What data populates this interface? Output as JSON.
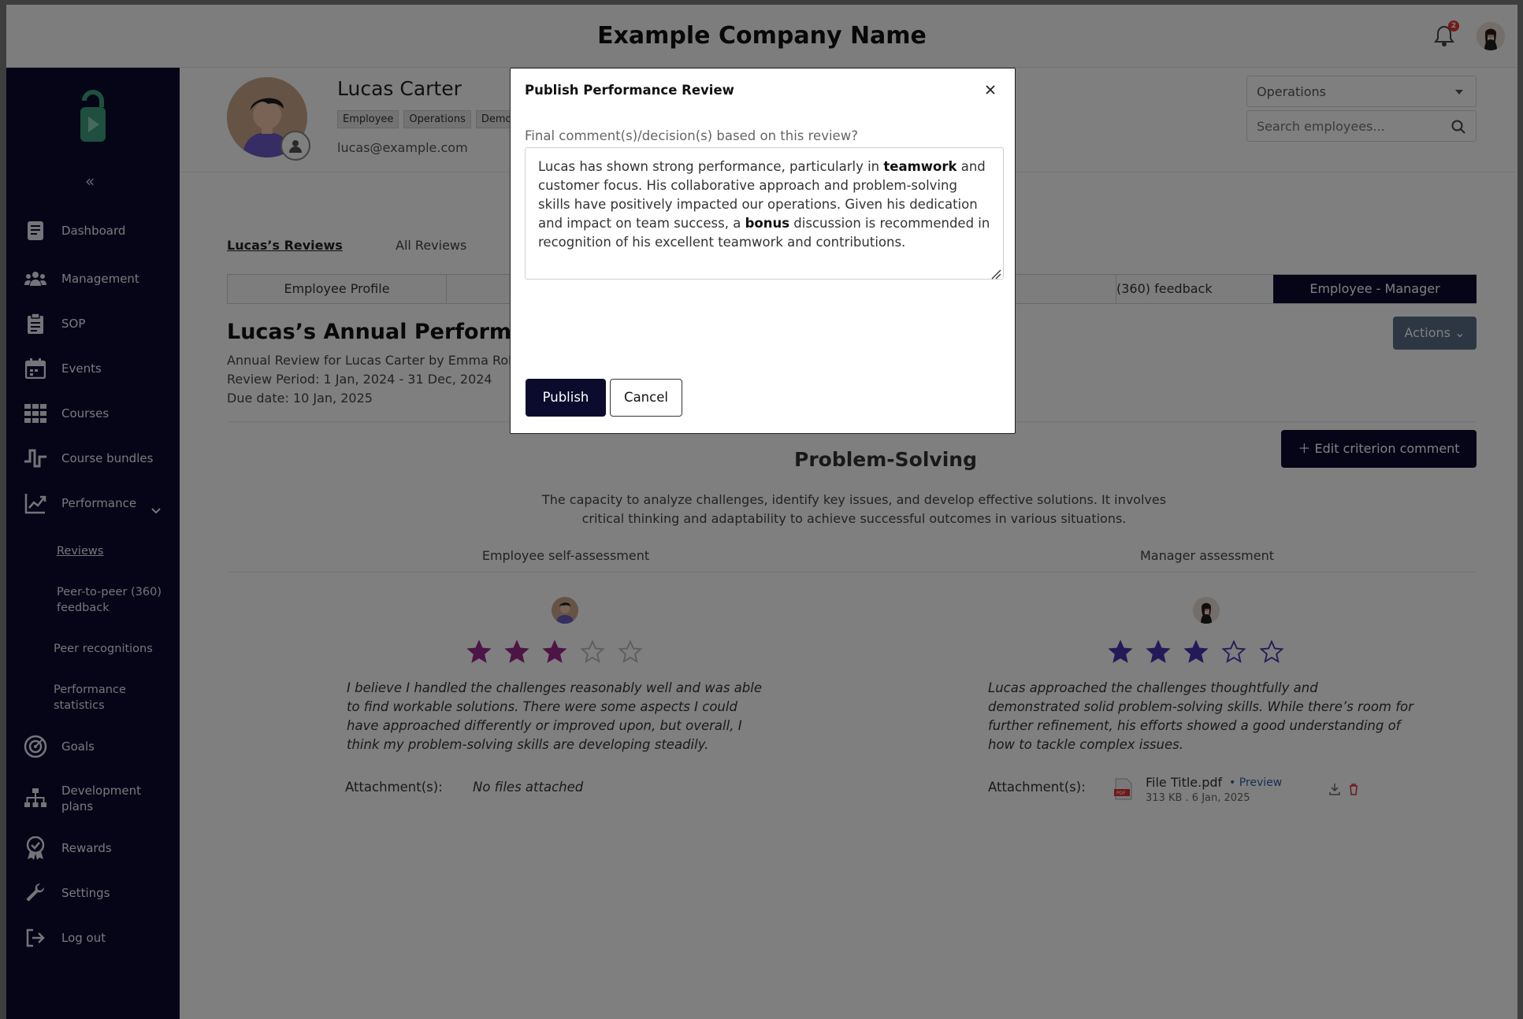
{
  "header": {
    "company_name": "Example Company Name",
    "notification_count": "2"
  },
  "sidebar": {
    "collapse_label": "«",
    "items": [
      {
        "label": "Dashboard",
        "icon": "dashboard-icon"
      },
      {
        "label": "Management",
        "icon": "management-icon"
      },
      {
        "label": "SOP",
        "icon": "clipboard-icon"
      },
      {
        "label": "Events",
        "icon": "calendar-icon"
      },
      {
        "label": "Courses",
        "icon": "grid-icon"
      },
      {
        "label": "Course bundles",
        "icon": "bundle-icon"
      },
      {
        "label": "Performance",
        "icon": "performance-icon"
      },
      {
        "label": "Goals",
        "icon": "target-icon"
      },
      {
        "label": "Development plans",
        "icon": "hierarchy-icon"
      },
      {
        "label": "Rewards",
        "icon": "award-icon"
      },
      {
        "label": "Settings",
        "icon": "wrench-icon"
      },
      {
        "label": "Log out",
        "icon": "logout-icon"
      }
    ],
    "performance_sub": [
      {
        "label": "Reviews"
      },
      {
        "label": "Peer-to-peer (360) feedback"
      },
      {
        "label": "Peer recognitions"
      },
      {
        "label": "Performance statistics"
      }
    ]
  },
  "profile": {
    "name": "Lucas Carter",
    "chips": [
      "Employee",
      "Operations",
      "Demo"
    ],
    "email": "lucas@example.com"
  },
  "filters": {
    "department": "Operations",
    "search_placeholder": "Search employees..."
  },
  "tabs": {
    "my_reviews": "Lucas’s Reviews",
    "all_reviews": "All Reviews"
  },
  "subtabs": {
    "employee_profile": "Employee Profile",
    "peer_feedback": "(360) feedback",
    "assessments": "Employee - Manager Assessments"
  },
  "review": {
    "title": "Lucas’s Annual Performance",
    "line1": "Annual Review for Lucas Carter by Emma Rob",
    "period": "Review Period: 1 Jan, 2024 - 31 Dec, 2024",
    "due": "Due date: 10 Jan, 2025",
    "actions_label": "Actions"
  },
  "criterion": {
    "edit_label": "Edit criterion comment",
    "title": "Problem-Solving",
    "description": "The capacity to analyze challenges, identify key issues, and develop effective solutions. It involves critical thinking and adaptability to achieve successful outcomes in various situations."
  },
  "self_assessment": {
    "heading": "Employee self-assessment",
    "rating": 3,
    "max_rating": 5,
    "star_color": "#9b2a8c",
    "comment": "I believe I handled the challenges reasonably well and was able to find workable solutions. There were some aspects I could have approached differently or improved upon, but overall, I think my problem-solving skills are developing steadily.",
    "attachments_label": "Attachment(s):",
    "attachments_empty": "No files attached"
  },
  "manager_assessment": {
    "heading": "Manager assessment",
    "rating": 3,
    "max_rating": 5,
    "star_color": "#4a34b0",
    "comment": "Lucas approached the challenges thoughtfully and demonstrated solid problem-solving skills. While there’s room for further refinement, his efforts showed a good understanding of how to tackle complex issues.",
    "attachments_label": "Attachment(s):",
    "file_name": "File Title.pdf",
    "file_preview": "Preview",
    "file_meta": "313 KB . 6 Jan, 2025"
  },
  "modal": {
    "title": "Publish Performance Review",
    "label": "Final comment(s)/decision(s) based on this review?",
    "text_part1": "Lucas has shown strong performance, particularly in ",
    "text_bold1": "teamwork",
    "text_part2": " and customer focus. His collaborative approach and problem-solving skills have positively impacted our operations. Given his dedication and impact on team success, a ",
    "text_bold2": "bonus",
    "text_part3": " discussion is recommended in recognition of his excellent teamwork and contributions.",
    "publish_label": "Publish",
    "cancel_label": "Cancel"
  },
  "colors": {
    "primary_dark": "#0b0b2e",
    "actions_button": "#5a6f88",
    "link_blue": "#2d5fa8"
  }
}
